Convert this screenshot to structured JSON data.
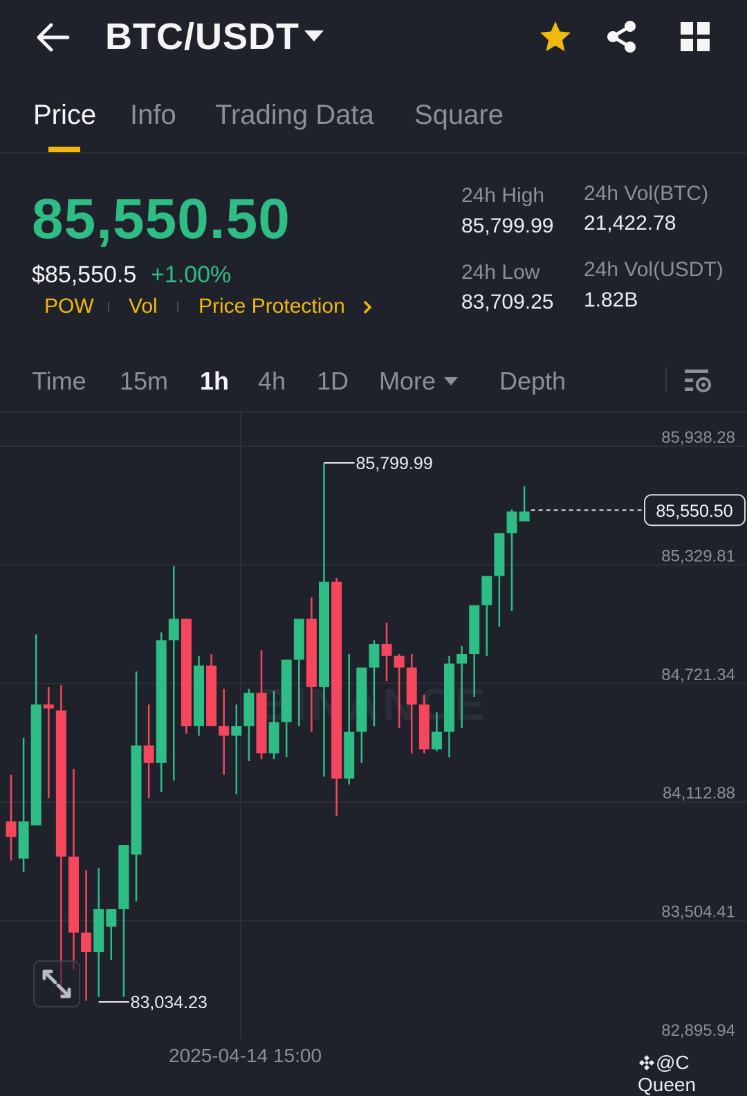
{
  "header": {
    "pair": "BTC/USDT",
    "icons": [
      "back-arrow-icon",
      "caret-down-icon",
      "star-icon",
      "share-icon",
      "grid-icon"
    ]
  },
  "tabs": [
    {
      "label": "Price",
      "active": true
    },
    {
      "label": "Info",
      "active": false
    },
    {
      "label": "Trading Data",
      "active": false
    },
    {
      "label": "Square",
      "active": false
    }
  ],
  "price": {
    "last": "85,550.50",
    "usd": "$85,550.5",
    "change": "+1.00%",
    "tags": [
      "POW",
      "Vol",
      "Price Protection"
    ]
  },
  "stats": {
    "high_label": "24h High",
    "high_value": "85,799.99",
    "low_label": "24h Low",
    "low_value": "83,709.25",
    "vol_btc_label": "24h Vol(BTC)",
    "vol_btc_value": "21,422.78",
    "vol_usdt_label": "24h Vol(USDT)",
    "vol_usdt_value": "1.82B"
  },
  "intervals": {
    "items": [
      "Time",
      "15m",
      "1h",
      "4h",
      "1D"
    ],
    "active": "1h",
    "more": "More",
    "depth": "Depth"
  },
  "chart_data": {
    "type": "candlestick",
    "interval": "1h",
    "y_ticks": [
      "85,938.28",
      "85,329.81",
      "84,721.34",
      "84,112.88",
      "83,504.41",
      "82,895.94"
    ],
    "ylim": [
      82895.94,
      85938.28
    ],
    "last_price_label": "85,550.50",
    "max_label": "85,799.99",
    "min_label": "83,034.23",
    "x_label": "2025-04-14 15:00",
    "watermark": "BINANCE",
    "colors": {
      "up": "#2ebd85",
      "down": "#f6465d",
      "grid": "#2b2f38",
      "axis_text": "#8a8f99"
    },
    "candles": [
      {
        "o": 83960,
        "h": 84200,
        "l": 83760,
        "c": 83880
      },
      {
        "o": 83770,
        "h": 84390,
        "l": 83700,
        "c": 83960
      },
      {
        "o": 83940,
        "h": 84920,
        "l": 84060,
        "c": 84560
      },
      {
        "o": 84560,
        "h": 84650,
        "l": 84080,
        "c": 84540
      },
      {
        "o": 84530,
        "h": 84660,
        "l": 83050,
        "c": 83780
      },
      {
        "o": 83780,
        "h": 84230,
        "l": 83200,
        "c": 83390
      },
      {
        "o": 83390,
        "h": 83710,
        "l": 83040,
        "c": 83290
      },
      {
        "o": 83290,
        "h": 83720,
        "l": 83060,
        "c": 83510
      },
      {
        "o": 83420,
        "h": 83250,
        "l": 83250,
        "c": 83510
      },
      {
        "o": 83510,
        "h": 83740,
        "l": 83060,
        "c": 83840
      },
      {
        "o": 83790,
        "h": 84730,
        "l": 83550,
        "c": 84350
      },
      {
        "o": 84350,
        "h": 84560,
        "l": 84080,
        "c": 84260
      },
      {
        "o": 84260,
        "h": 84930,
        "l": 84110,
        "c": 84890
      },
      {
        "o": 84890,
        "h": 85270,
        "l": 84170,
        "c": 85000
      },
      {
        "o": 85000,
        "h": 84940,
        "l": 84410,
        "c": 84450
      },
      {
        "o": 84450,
        "h": 84810,
        "l": 84400,
        "c": 84760
      },
      {
        "o": 84760,
        "h": 84820,
        "l": 84460,
        "c": 84450
      },
      {
        "o": 84450,
        "h": 84640,
        "l": 84200,
        "c": 84400
      },
      {
        "o": 84400,
        "h": 84560,
        "l": 84100,
        "c": 84450
      },
      {
        "o": 84450,
        "h": 84640,
        "l": 84270,
        "c": 84620
      },
      {
        "o": 84620,
        "h": 84840,
        "l": 84280,
        "c": 84310
      },
      {
        "o": 84310,
        "h": 84630,
        "l": 84280,
        "c": 84470
      },
      {
        "o": 84470,
        "h": 84640,
        "l": 84290,
        "c": 84790
      },
      {
        "o": 84790,
        "h": 84910,
        "l": 84450,
        "c": 85000
      },
      {
        "o": 85000,
        "h": 85110,
        "l": 84420,
        "c": 84650
      },
      {
        "o": 84650,
        "h": 85800,
        "l": 84190,
        "c": 85190
      },
      {
        "o": 85190,
        "h": 85210,
        "l": 83990,
        "c": 84180
      },
      {
        "o": 84180,
        "h": 84820,
        "l": 84150,
        "c": 84420
      },
      {
        "o": 84420,
        "h": 84640,
        "l": 84260,
        "c": 84750
      },
      {
        "o": 84750,
        "h": 84890,
        "l": 84450,
        "c": 84870
      },
      {
        "o": 84870,
        "h": 84980,
        "l": 84680,
        "c": 84810
      },
      {
        "o": 84810,
        "h": 84820,
        "l": 84440,
        "c": 84750
      },
      {
        "o": 84750,
        "h": 84820,
        "l": 84310,
        "c": 84560
      },
      {
        "o": 84560,
        "h": 84610,
        "l": 84310,
        "c": 84330
      },
      {
        "o": 84330,
        "h": 84520,
        "l": 84320,
        "c": 84420
      },
      {
        "o": 84420,
        "h": 84810,
        "l": 84290,
        "c": 84770
      },
      {
        "o": 84770,
        "h": 84860,
        "l": 84440,
        "c": 84820
      },
      {
        "o": 84820,
        "h": 85010,
        "l": 84600,
        "c": 85070
      },
      {
        "o": 85070,
        "h": 85210,
        "l": 84810,
        "c": 85220
      },
      {
        "o": 85220,
        "h": 85340,
        "l": 84960,
        "c": 85440
      },
      {
        "o": 85440,
        "h": 85560,
        "l": 85040,
        "c": 85550
      },
      {
        "o": 85500,
        "h": 85680,
        "l": 85500,
        "c": 85550
      }
    ]
  },
  "credit": "@C Queen"
}
